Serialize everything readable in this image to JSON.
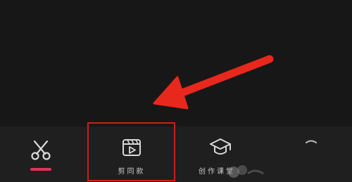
{
  "tabs": [
    {
      "id": "cut",
      "label": "",
      "icon": "scissors-icon",
      "active": true
    },
    {
      "id": "template",
      "label": "剪同款",
      "icon": "video-template-icon",
      "active": false
    },
    {
      "id": "course",
      "label": "创作课堂",
      "icon": "graduation-cap-icon",
      "active": false
    },
    {
      "id": "more",
      "label": "",
      "icon": "more-icon",
      "active": false
    }
  ],
  "annotation": {
    "arrow_icon": "red-arrow-icon",
    "highlight": "red-highlight-box",
    "color": "#e8281d"
  },
  "colors": {
    "background": "#171717",
    "tab_bar": "#1f1f1f",
    "active_accent": "#e1325a",
    "icon": "#d8d8d8",
    "label": "#c9c9c9"
  }
}
